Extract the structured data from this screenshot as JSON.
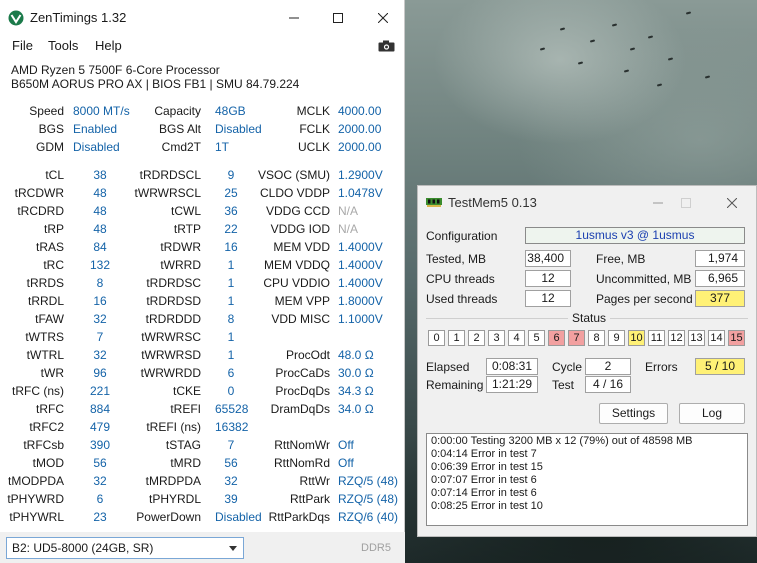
{
  "zentimings": {
    "title": "ZenTimings 1.32",
    "menu": [
      "File",
      "Tools",
      "Help"
    ],
    "cpu": "AMD Ryzen 5 7500F 6-Core Processor",
    "board": "B650M AORUS PRO AX | BIOS FB1 | SMU 84.79.224",
    "summary": [
      [
        {
          "label": "Speed",
          "value": "8000 MT/s"
        },
        {
          "label": "Capacity",
          "value": "48GB"
        },
        {
          "label": "MCLK",
          "value": "4000.00"
        }
      ],
      [
        {
          "label": "BGS",
          "value": "Enabled"
        },
        {
          "label": "BGS Alt",
          "value": "Disabled"
        },
        {
          "label": "FCLK",
          "value": "2000.00"
        }
      ],
      [
        {
          "label": "GDM",
          "value": "Disabled"
        },
        {
          "label": "Cmd2T",
          "value": "1T"
        },
        {
          "label": "UCLK",
          "value": "2000.00"
        }
      ]
    ],
    "timings": [
      [
        {
          "label": "tCL",
          "value": "38"
        },
        {
          "label": "tRDRDSCL",
          "value": "9"
        },
        {
          "label": "VSOC (SMU)",
          "value": "1.2900V"
        }
      ],
      [
        {
          "label": "tRCDWR",
          "value": "48"
        },
        {
          "label": "tWRWRSCL",
          "value": "25"
        },
        {
          "label": "CLDO VDDP",
          "value": "1.0478V"
        }
      ],
      [
        {
          "label": "tRCDRD",
          "value": "48"
        },
        {
          "label": "tCWL",
          "value": "36"
        },
        {
          "label": "VDDG CCD",
          "value": "N/A",
          "disabled": true
        }
      ],
      [
        {
          "label": "tRP",
          "value": "48"
        },
        {
          "label": "tRTP",
          "value": "22"
        },
        {
          "label": "VDDG IOD",
          "value": "N/A",
          "disabled": true
        }
      ],
      [
        {
          "label": "tRAS",
          "value": "84"
        },
        {
          "label": "tRDWR",
          "value": "16"
        },
        {
          "label": "MEM VDD",
          "value": "1.4000V"
        }
      ],
      [
        {
          "label": "tRC",
          "value": "132"
        },
        {
          "label": "tWRRD",
          "value": "1"
        },
        {
          "label": "MEM VDDQ",
          "value": "1.4000V"
        }
      ],
      [
        {
          "label": "tRRDS",
          "value": "8"
        },
        {
          "label": "tRDRDSC",
          "value": "1"
        },
        {
          "label": "CPU VDDIO",
          "value": "1.4000V"
        }
      ],
      [
        {
          "label": "tRRDL",
          "value": "16"
        },
        {
          "label": "tRDRDSD",
          "value": "1"
        },
        {
          "label": "MEM VPP",
          "value": "1.8000V"
        }
      ],
      [
        {
          "label": "tFAW",
          "value": "32"
        },
        {
          "label": "tRDRDDD",
          "value": "8"
        },
        {
          "label": "VDD MISC",
          "value": "1.1000V"
        }
      ],
      [
        {
          "label": "tWTRS",
          "value": "7"
        },
        {
          "label": "tWRWRSC",
          "value": "1"
        },
        {
          "label": "",
          "value": ""
        }
      ],
      [
        {
          "label": "tWTRL",
          "value": "32"
        },
        {
          "label": "tWRWRSD",
          "value": "1"
        },
        {
          "label": "ProcOdt",
          "value": "48.0 Ω"
        }
      ],
      [
        {
          "label": "tWR",
          "value": "96"
        },
        {
          "label": "tWRWRDD",
          "value": "6"
        },
        {
          "label": "ProcCaDs",
          "value": "30.0 Ω"
        }
      ],
      [
        {
          "label": "tRFC (ns)",
          "value": "221"
        },
        {
          "label": "tCKE",
          "value": "0"
        },
        {
          "label": "ProcDqDs",
          "value": "34.3 Ω"
        }
      ],
      [
        {
          "label": "tRFC",
          "value": "884"
        },
        {
          "label": "tREFI",
          "value": "65528"
        },
        {
          "label": "DramDqDs",
          "value": "34.0 Ω"
        }
      ],
      [
        {
          "label": "tRFC2",
          "value": "479"
        },
        {
          "label": "tREFI (ns)",
          "value": "16382"
        },
        {
          "label": "",
          "value": ""
        }
      ],
      [
        {
          "label": "tRFCsb",
          "value": "390"
        },
        {
          "label": "tSTAG",
          "value": "7"
        },
        {
          "label": "RttNomWr",
          "value": "Off"
        }
      ],
      [
        {
          "label": "tMOD",
          "value": "56"
        },
        {
          "label": "tMRD",
          "value": "56"
        },
        {
          "label": "RttNomRd",
          "value": "Off"
        }
      ],
      [
        {
          "label": "tMODPDA",
          "value": "32"
        },
        {
          "label": "tMRDPDA",
          "value": "32"
        },
        {
          "label": "RttWr",
          "value": "RZQ/5 (48)"
        }
      ],
      [
        {
          "label": "tPHYWRD",
          "value": "6"
        },
        {
          "label": "tPHYRDL",
          "value": "39"
        },
        {
          "label": "RttPark",
          "value": "RZQ/5 (48)"
        }
      ],
      [
        {
          "label": "tPHYWRL",
          "value": "23"
        },
        {
          "label": "PowerDown",
          "value": "Disabled"
        },
        {
          "label": "RttParkDqs",
          "value": "RZQ/6 (40)"
        }
      ]
    ],
    "module_select": "B2: UD5-8000 (24GB, SR)",
    "memory_type": "DDR5"
  },
  "testmem": {
    "title": "TestMem5  0.13",
    "configuration_label": "Configuration",
    "configuration_value": "1usmus v3 @ 1usmus",
    "tested_label": "Tested, MB",
    "tested_value": "38,400",
    "free_label": "Free, MB",
    "free_value": "1,974",
    "cpu_threads_label": "CPU threads",
    "cpu_threads_value": "12",
    "uncommitted_label": "Uncommitted, MB",
    "uncommitted_value": "6,965",
    "used_threads_label": "Used threads",
    "used_threads_value": "12",
    "pages_label": "Pages per second",
    "pages_value": "377",
    "status_label": "Status",
    "tests": [
      {
        "n": "0",
        "state": "ok"
      },
      {
        "n": "1",
        "state": "ok"
      },
      {
        "n": "2",
        "state": "ok"
      },
      {
        "n": "3",
        "state": "ok"
      },
      {
        "n": "4",
        "state": "ok"
      },
      {
        "n": "5",
        "state": "ok"
      },
      {
        "n": "6",
        "state": "error"
      },
      {
        "n": "7",
        "state": "error"
      },
      {
        "n": "8",
        "state": "ok"
      },
      {
        "n": "9",
        "state": "ok"
      },
      {
        "n": "10",
        "state": "running"
      },
      {
        "n": "11",
        "state": "ok"
      },
      {
        "n": "12",
        "state": "ok"
      },
      {
        "n": "13",
        "state": "ok"
      },
      {
        "n": "14",
        "state": "ok"
      },
      {
        "n": "15",
        "state": "error"
      }
    ],
    "elapsed_label": "Elapsed",
    "elapsed_value": "0:08:31",
    "cycle_label": "Cycle",
    "cycle_value": "2",
    "errors_label": "Errors",
    "errors_value": "5 / 10",
    "remaining_label": "Remaining",
    "remaining_value": "1:21:29",
    "test_label": "Test",
    "test_value": "4 / 16",
    "settings_button": "Settings",
    "log_button": "Log",
    "log": [
      {
        "time": "0:00:00",
        "text": "Testing 3200 MB x 12 (79%) out of 48598 MB"
      },
      {
        "time": "0:04:14",
        "text": "Error in test 7"
      },
      {
        "time": "0:06:39",
        "text": "Error in test 15"
      },
      {
        "time": "0:07:07",
        "text": "Error in test 6"
      },
      {
        "time": "0:07:14",
        "text": "Error in test 6"
      },
      {
        "time": "0:08:25",
        "text": "Error in test 10"
      }
    ]
  },
  "colors": {
    "value_blue": "#1463a8",
    "error_red": "#f2a0a0",
    "running_yellow": "#fff176",
    "disabled_gray": "#a9a9a9"
  }
}
